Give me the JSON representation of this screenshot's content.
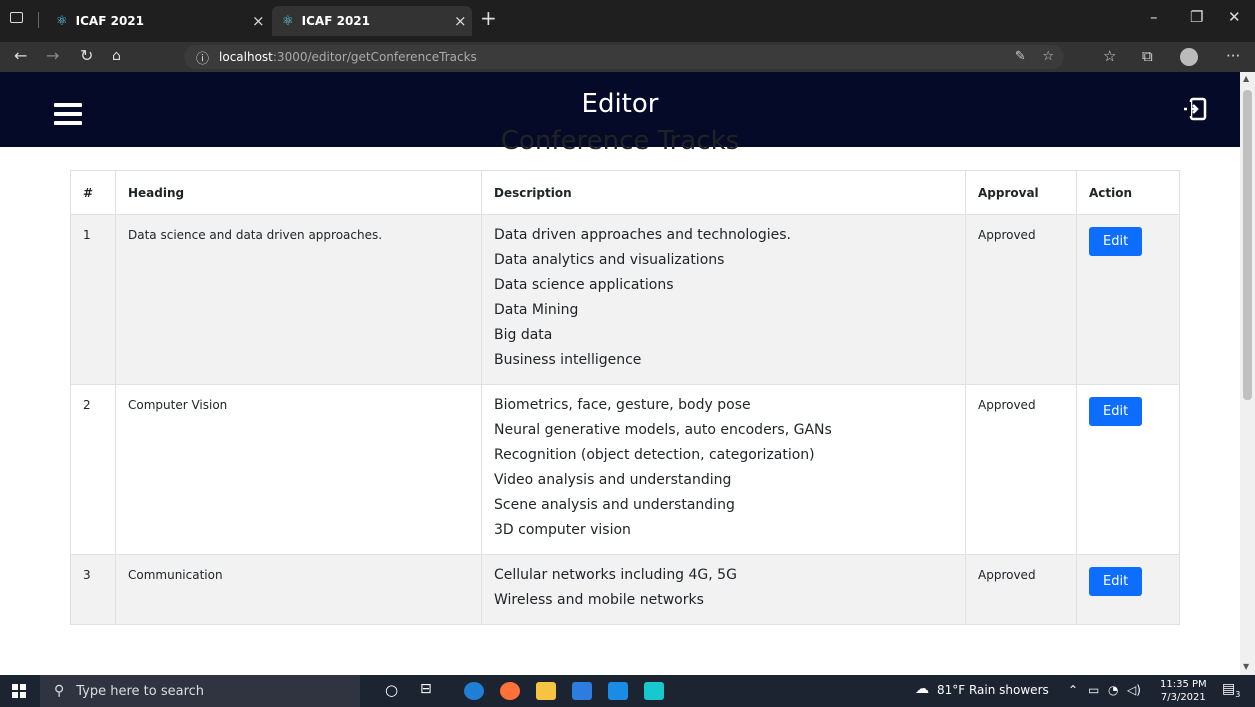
{
  "browser": {
    "tabs": [
      {
        "title": "ICAF 2021"
      },
      {
        "title": "ICAF 2021"
      }
    ],
    "address": {
      "host": "localhost",
      "path": ":3000/editor/getConferenceTracks"
    }
  },
  "app": {
    "title": "Editor"
  },
  "page": {
    "title": "Conference Tracks",
    "columns": [
      "#",
      "Heading",
      "Description",
      "Approval",
      "Action"
    ],
    "rows": [
      {
        "num": "1",
        "heading": "Data science and data driven approaches.",
        "description": [
          "Data driven approaches and technologies.",
          "Data analytics and visualizations",
          "Data science applications",
          "Data Mining",
          "Big data",
          "Business intelligence"
        ],
        "approval": "Approved",
        "action": "Edit"
      },
      {
        "num": "2",
        "heading": "Computer Vision",
        "description": [
          "Biometrics, face, gesture, body pose",
          "Neural generative models, auto encoders, GANs",
          "Recognition (object detection, categorization)",
          "Video analysis and understanding",
          "Scene analysis and understanding",
          "3D computer vision"
        ],
        "approval": "Approved",
        "action": "Edit"
      },
      {
        "num": "3",
        "heading": "Communication",
        "description": [
          "Cellular networks including 4G, 5G",
          "Wireless and mobile networks"
        ],
        "approval": "Approved",
        "action": "Edit"
      }
    ]
  },
  "taskbar": {
    "search_placeholder": "Type here to search",
    "weather": "81°F  Rain showers",
    "time": "11:35 PM",
    "date": "7/3/2021",
    "notifications": "3"
  },
  "colors": {
    "header_bg": "#050a28",
    "button": "#0d6efd"
  }
}
